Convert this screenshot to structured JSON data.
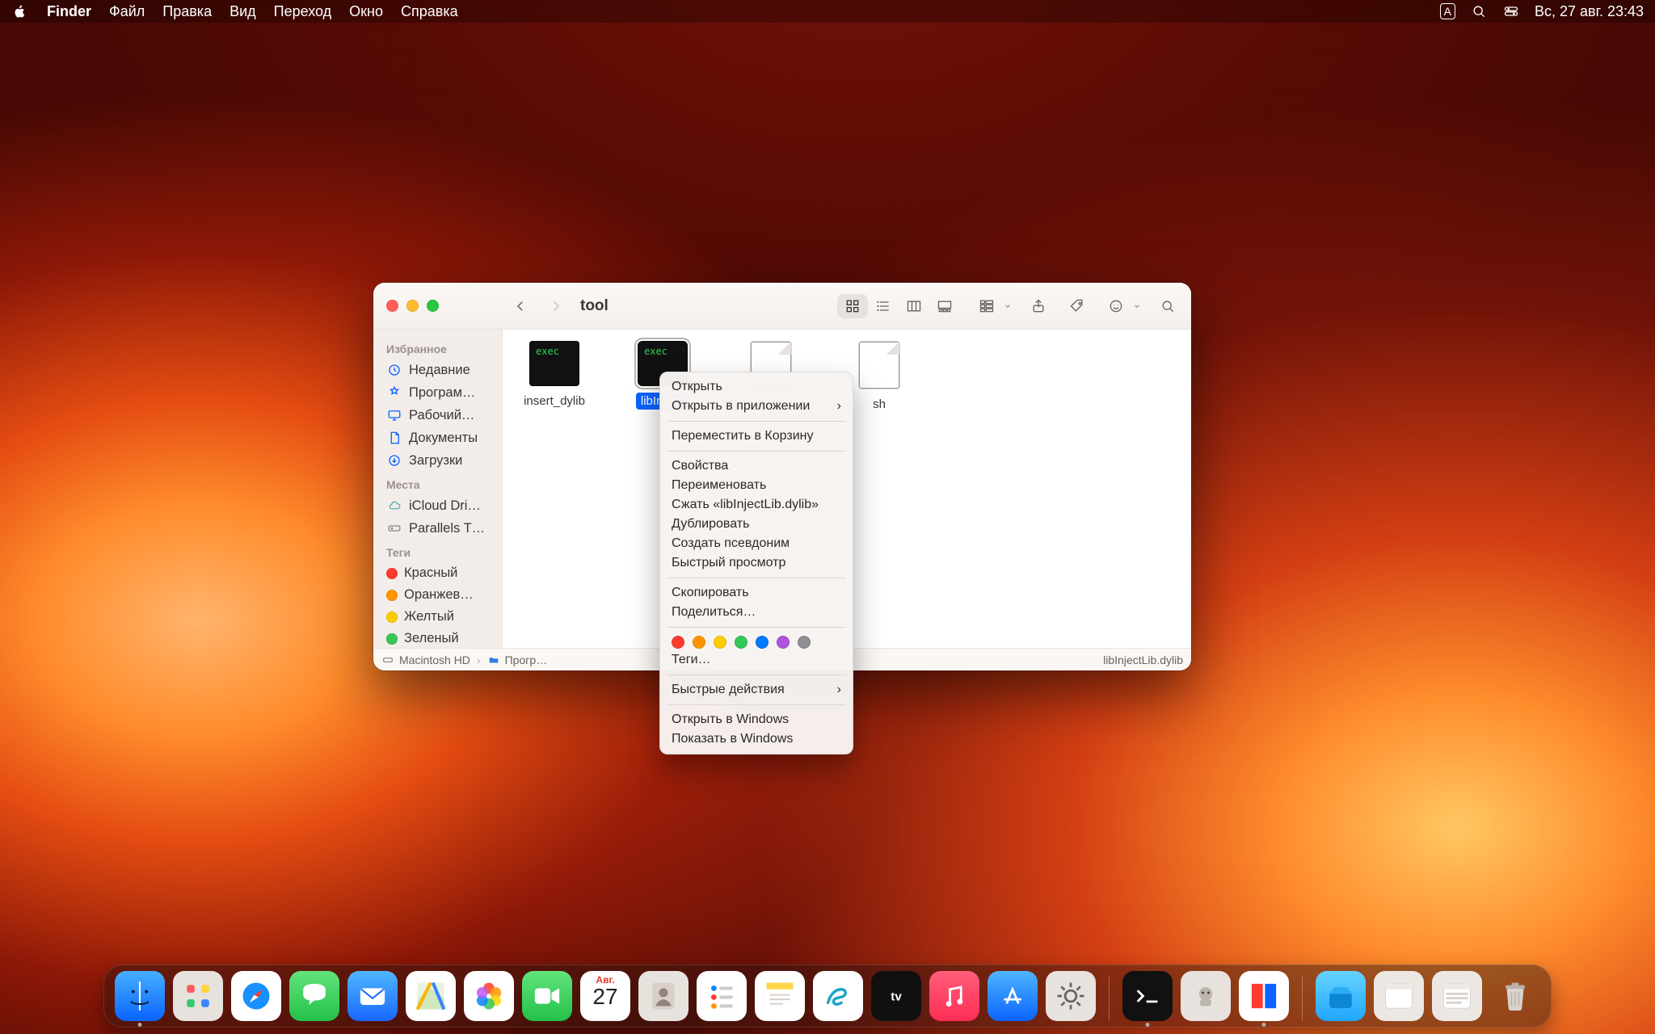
{
  "menubar": {
    "app_name": "Finder",
    "items": [
      "Файл",
      "Правка",
      "Вид",
      "Переход",
      "Окно",
      "Справка"
    ],
    "input_indicator": "A",
    "datetime": "Вс, 27 авг.  23:43"
  },
  "window": {
    "title": "tool",
    "sidebar": {
      "section_favorites": "Избранное",
      "favorites": [
        {
          "label": "Недавние",
          "icon": "clock-icon"
        },
        {
          "label": "Програм…",
          "icon": "apps-icon"
        },
        {
          "label": "Рабочий…",
          "icon": "desktop-icon"
        },
        {
          "label": "Документы",
          "icon": "document-icon"
        },
        {
          "label": "Загрузки",
          "icon": "download-icon"
        }
      ],
      "section_locations": "Места",
      "locations": [
        {
          "label": "iCloud Dri…",
          "icon": "cloud-icon"
        },
        {
          "label": "Parallels T…",
          "icon": "drive-icon"
        }
      ],
      "section_tags": "Теги",
      "tags": [
        {
          "label": "Красный",
          "color": "#ff3b30"
        },
        {
          "label": "Оранжев…",
          "color": "#ff9500"
        },
        {
          "label": "Желтый",
          "color": "#ffcc00"
        },
        {
          "label": "Зеленый",
          "color": "#34c759"
        }
      ]
    },
    "files": [
      {
        "name": "insert_dylib",
        "kind": "exec",
        "selected": false
      },
      {
        "name": "libInjectl",
        "kind": "exec",
        "selected": true
      },
      {
        "name": "",
        "kind": "doc",
        "selected": false,
        "name_suffix": ""
      },
      {
        "name": "sh",
        "kind": "doc",
        "selected": false
      }
    ],
    "path": {
      "root": "Macintosh HD",
      "segment": "Прогр…",
      "leaf": "libInjectLib.dylib"
    }
  },
  "context_menu": {
    "open": "Открыть",
    "open_with": "Открыть в приложении",
    "move_to_trash": "Переместить в Корзину",
    "get_info": "Свойства",
    "rename": "Переименовать",
    "compress": "Сжать «libInjectLib.dylib»",
    "duplicate": "Дублировать",
    "make_alias": "Создать псевдоним",
    "quick_look": "Быстрый просмотр",
    "copy": "Скопировать",
    "share": "Поделиться…",
    "tags": "Теги…",
    "quick_actions": "Быстрые действия",
    "open_in_windows": "Открыть в Windows",
    "show_in_windows": "Показать в Windows",
    "tag_colors": [
      "#ff3b30",
      "#ff9500",
      "#ffcc00",
      "#34c759",
      "#007aff",
      "#af52de",
      "#8e8e93"
    ]
  },
  "dock": {
    "calendar_month": "Авг.",
    "calendar_day": "27"
  }
}
